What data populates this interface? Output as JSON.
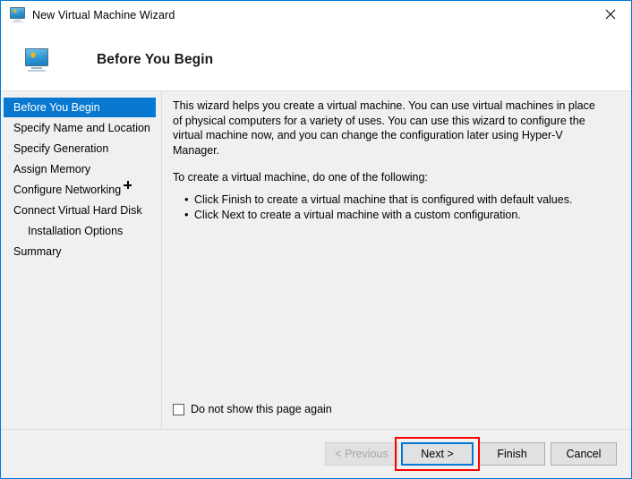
{
  "window": {
    "title": "New Virtual Machine Wizard",
    "title_icon": "virtual-machine-monitor-icon",
    "close_label": "✕",
    "border_color": "#0078d7"
  },
  "header": {
    "title": "Before You Begin",
    "icon": "virtual-machine-monitor-icon"
  },
  "sidebar": {
    "items": [
      {
        "label": "Before You Begin",
        "selected": true,
        "indented": false
      },
      {
        "label": "Specify Name and Location",
        "selected": false,
        "indented": false
      },
      {
        "label": "Specify Generation",
        "selected": false,
        "indented": false
      },
      {
        "label": "Assign Memory",
        "selected": false,
        "indented": false
      },
      {
        "label": "Configure Networking",
        "selected": false,
        "indented": false
      },
      {
        "label": "Connect Virtual Hard Disk",
        "selected": false,
        "indented": false
      },
      {
        "label": "Installation Options",
        "selected": false,
        "indented": true
      },
      {
        "label": "Summary",
        "selected": false,
        "indented": false
      }
    ],
    "selection_color": "#0878d0"
  },
  "main": {
    "paragraph1": "This wizard helps you create a virtual machine. You can use virtual machines in place of physical computers for a variety of uses. You can use this wizard to configure the virtual machine now, and you can change the configuration later using Hyper-V Manager.",
    "paragraph2": "To create a virtual machine, do one of the following:",
    "bullets": [
      "Click Finish to create a virtual machine that is configured with default values.",
      "Click Next to create a virtual machine with a custom configuration."
    ],
    "checkbox": {
      "label": "Do not show this page again",
      "checked": false
    }
  },
  "footer": {
    "buttons": [
      {
        "id": "previous",
        "label": "< Previous",
        "disabled": true,
        "focused": false
      },
      {
        "id": "next",
        "label": "Next >",
        "disabled": false,
        "focused": true
      },
      {
        "id": "finish",
        "label": "Finish",
        "disabled": false,
        "focused": false
      },
      {
        "id": "cancel",
        "label": "Cancel",
        "disabled": false,
        "focused": false
      }
    ],
    "highlight": {
      "target": "next",
      "color": "#ff0000"
    }
  }
}
